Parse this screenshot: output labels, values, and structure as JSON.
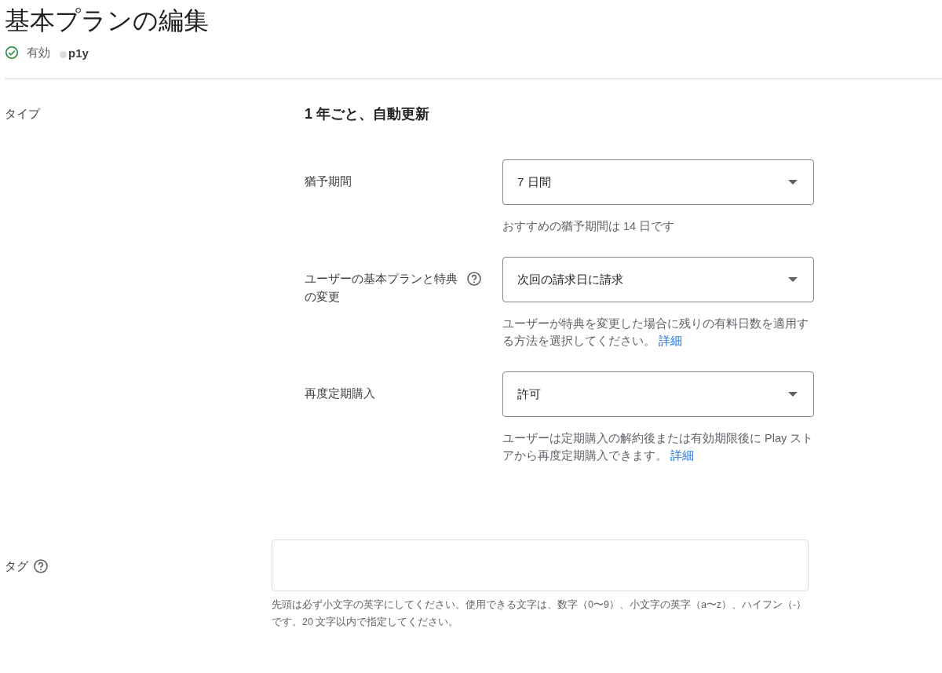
{
  "page": {
    "title": "基本プランの編集",
    "status": {
      "label": "有効",
      "active": true
    },
    "plan_id": "p1y"
  },
  "type_row": {
    "label": "タイプ",
    "value": "1 年ごと、自動更新"
  },
  "settings": [
    {
      "label": "猶予期間",
      "help_icon": false,
      "value": "7 日間",
      "hint": "おすすめの猶予期間は 14 日です"
    },
    {
      "label": "ユーザーの基本プランと特典の変更",
      "help_icon": true,
      "value": "次回の請求日に請求",
      "hint": "ユーザーが特典を変更した場合に残りの有料日数を適用する方法を選択してください。",
      "link": "詳細"
    },
    {
      "label": "再度定期購入",
      "help_icon": false,
      "value": "許可",
      "hint": "ユーザーは定期購入の解約後または有効期限後に Play ストアから再度定期購入できます。",
      "link": "詳細"
    }
  ],
  "tags": {
    "label": "タグ",
    "help_icon": true,
    "hint": "先頭は必ず小文字の英字にしてください。使用できる文字は、数字（0〜9）、小文字の英字（a〜z）、ハイフン（-）です。20 文字以内で指定してください。"
  }
}
